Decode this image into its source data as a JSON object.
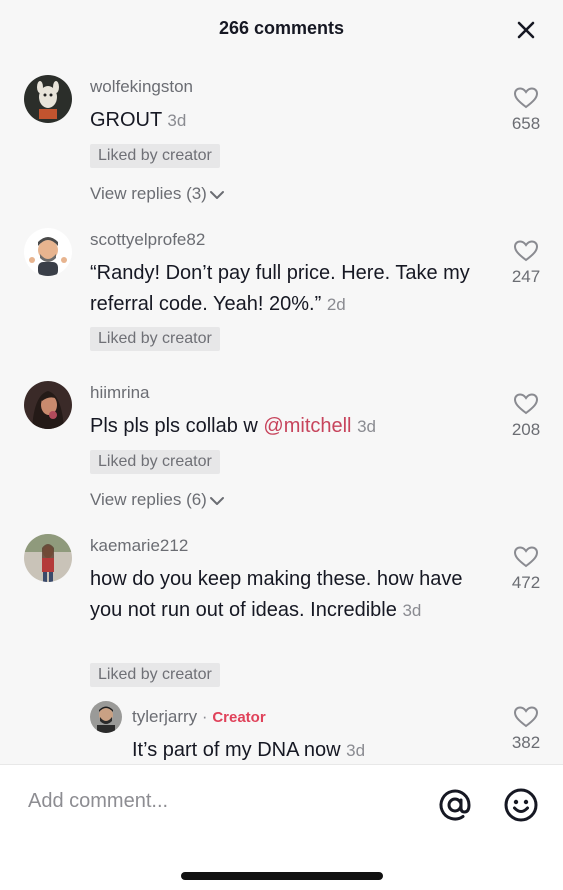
{
  "header": {
    "title": "266 comments"
  },
  "comments": [
    {
      "username": "wolfekingston",
      "text": "GROUT",
      "time": "3d",
      "liked_label": "Liked by creator",
      "replies_label": "View replies (3)",
      "likes": "658"
    },
    {
      "username": "scottyelprofe82",
      "text": "“Randy! Don’t pay full price. Here. Take my referral code. Yeah! 20%.”",
      "time": "2d",
      "liked_label": "Liked by creator",
      "likes": "247"
    },
    {
      "username": "hiimrina",
      "text_before": "Pls pls pls collab w ",
      "mention": "@mitchell",
      "time": "3d",
      "liked_label": "Liked by creator",
      "replies_label": "View replies (6)",
      "likes": "208"
    },
    {
      "username": "kaemarie212",
      "text": "how do you keep making these. how have you not run out of ideas. Incredible",
      "time": "3d",
      "liked_label": "Liked by creator",
      "likes": "472"
    }
  ],
  "reply": {
    "username": "tylerjarry",
    "separator": "·",
    "creator_label": "Creator",
    "text": "It’s part of my DNA now",
    "time": "3d",
    "likes": "382"
  },
  "footer": {
    "placeholder": "Add comment..."
  },
  "icons": {
    "close": "close-icon",
    "heart": "heart-outline-icon",
    "chevron": "chevron-down-icon",
    "at": "at-sign-icon",
    "emoji": "emoji-icon"
  }
}
